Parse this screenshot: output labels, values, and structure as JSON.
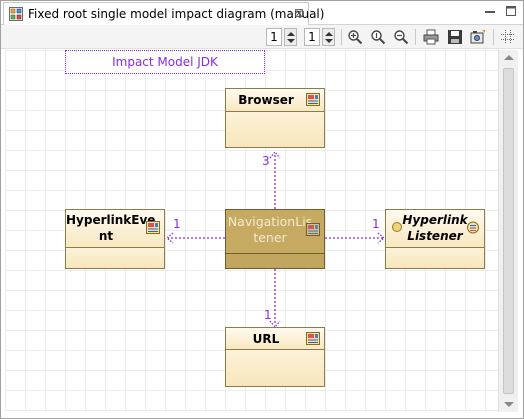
{
  "tab": {
    "title": "Fixed root single model impact diagram (manual)",
    "close_glyph": "⊠"
  },
  "toolbar": {
    "spin1_value": "1",
    "spin2_value": "1"
  },
  "diagram": {
    "impact_label": "Impact Model JDK",
    "classes": {
      "browser": "Browser",
      "navigation_listener": [
        "NavigationLis",
        "tener"
      ],
      "hyperlink_event": [
        "HyperlinkEve",
        "nt"
      ],
      "hyperlink_listener": [
        "Hyperlink",
        "Listener"
      ],
      "url": "URL"
    },
    "multiplicities": {
      "to_browser": "3",
      "to_hyperlink_event": "1",
      "to_hyperlink_listener": "1",
      "to_url": "1"
    },
    "colors": {
      "edge": "#8a2be2",
      "class_fill": "#fdf4dd",
      "selected_fill": "#c2a55e"
    }
  }
}
